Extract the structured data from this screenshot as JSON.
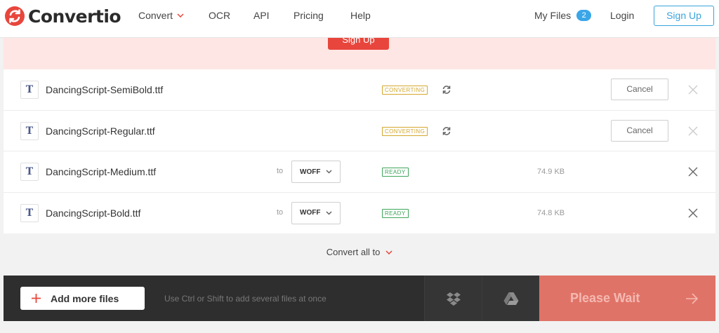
{
  "header": {
    "logo_text": "Convertio",
    "nav": {
      "convert": "Convert",
      "ocr": "OCR",
      "api": "API",
      "pricing": "Pricing",
      "help": "Help",
      "my_files": "My Files",
      "my_files_count": "2",
      "login": "Login",
      "signup": "Sign Up"
    }
  },
  "banner": {
    "button_label": "Sign Up"
  },
  "files": [
    {
      "name": "DancingScript-SemiBold.ttf",
      "status": "CONVERTING",
      "action": "Cancel"
    },
    {
      "name": "DancingScript-Regular.ttf",
      "status": "CONVERTING",
      "action": "Cancel"
    },
    {
      "name": "DancingScript-Medium.ttf",
      "to_label": "to",
      "format": "WOFF",
      "status": "READY",
      "size": "74.9 KB"
    },
    {
      "name": "DancingScript-Bold.ttf",
      "to_label": "to",
      "format": "WOFF",
      "status": "READY",
      "size": "74.8 KB"
    }
  ],
  "file_icon_glyph": "T",
  "convert_all": {
    "label": "Convert all to"
  },
  "bottom_bar": {
    "add_files": "Add more files",
    "hint": "Use Ctrl or Shift to add several files at once",
    "wait_label": "Please Wait"
  },
  "colors": {
    "brand_red": "#e8463c",
    "accent_blue": "#39a4dc",
    "converting": "#d4a72c",
    "ready": "#3fa55a",
    "wait_button": "#e07367"
  }
}
